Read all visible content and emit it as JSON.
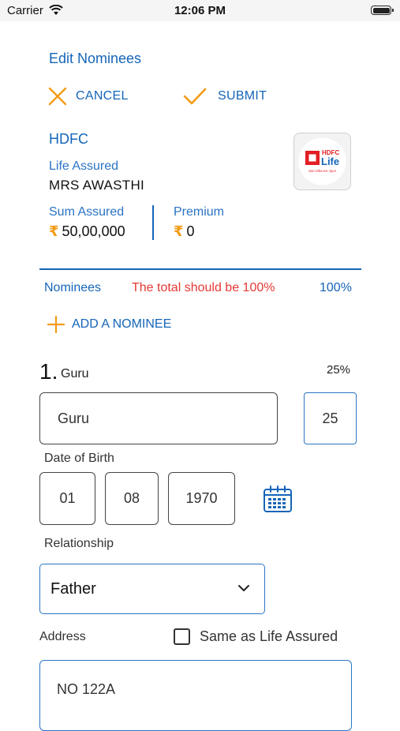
{
  "status_bar": {
    "carrier": "Carrier",
    "time": "12:06 PM"
  },
  "header": {
    "title": "Edit Nominees"
  },
  "actions": {
    "cancel_label": "CANCEL",
    "submit_label": "SUBMIT"
  },
  "policy": {
    "company": "HDFC",
    "life_assured_label": "Life Assured",
    "life_assured_value": "MRS AWASTHI",
    "sum_assured_label": "Sum Assured",
    "sum_assured_value": "50,00,000",
    "premium_label": "Premium",
    "premium_value": "0",
    "currency_symbol": "₹",
    "logo": {
      "line1": "HDFC",
      "line2": "Life",
      "tagline": "Sar Utha Ke Jiyo!"
    }
  },
  "nominees": {
    "label": "Nominees",
    "warning": "The total should be 100%",
    "total": "100%",
    "add_label": "ADD A NOMINEE"
  },
  "nominee_1": {
    "number": "1.",
    "name": "Guru",
    "share_percent": "25%",
    "name_value": "Guru",
    "share_value": "25",
    "dob_label": "Date of Birth",
    "dob_day": "01",
    "dob_month": "08",
    "dob_year": "1970",
    "relationship_label": "Relationship",
    "relationship_value": "Father",
    "address_label": "Address",
    "same_as_label": "Same as Life Assured",
    "same_as_checked": false,
    "address_value": "NO 122A"
  },
  "colors": {
    "primary_blue": "#1565b8",
    "accent_orange": "#f29b16",
    "warning_red": "#e53935",
    "hdfc_red": "#e31e24"
  },
  "icons": [
    "wifi-icon",
    "battery-icon",
    "close-icon",
    "check-icon",
    "plus-icon",
    "calendar-icon",
    "chevron-down-icon"
  ]
}
